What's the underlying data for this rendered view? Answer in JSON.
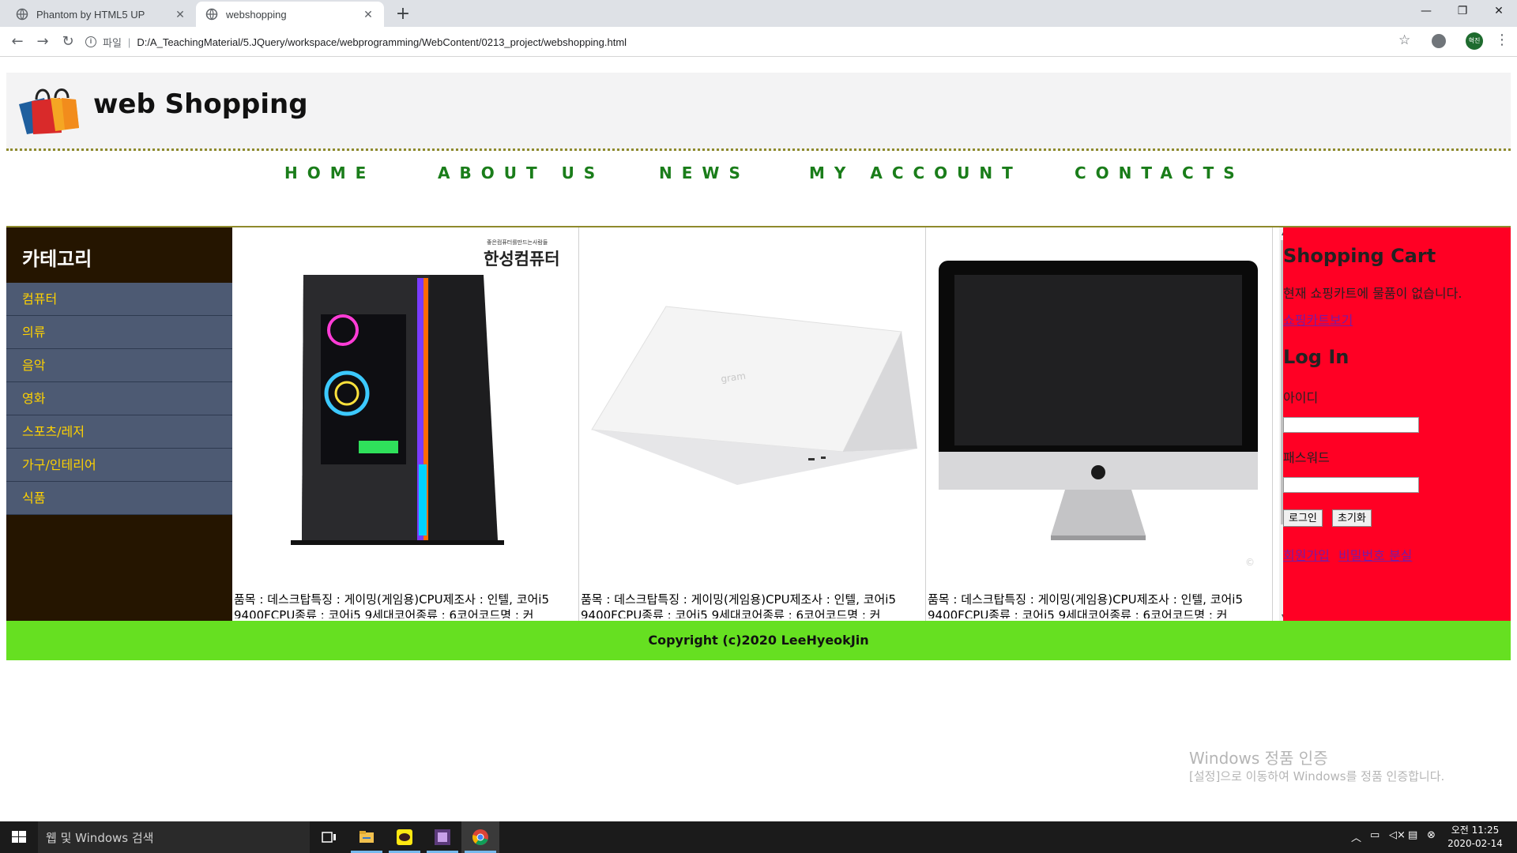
{
  "browser": {
    "tabs": [
      {
        "title": "Phantom by HTML5 UP",
        "active": false
      },
      {
        "title": "webshopping",
        "active": true
      }
    ],
    "new_tab": "+",
    "window_controls": {
      "minimize": "—",
      "restore": "❐",
      "close": "✕"
    },
    "address": {
      "scheme_label": "파일",
      "separator": "|",
      "url": "D:/A_TeachingMaterial/5.JQuery/workspace/webprogramming/WebContent/0213_project/webshopping.html"
    },
    "profile_label": "혁진"
  },
  "site": {
    "title": "web Shopping",
    "nav": [
      "HOME",
      "ABOUT US",
      "NEWS",
      "MY ACCOUNT",
      "CONTACTS"
    ]
  },
  "sidebar": {
    "title": "카테고리",
    "categories": [
      "컴퓨터",
      "의류",
      "음악",
      "영화",
      "스포츠/레저",
      "가구/인테리어",
      "식품"
    ]
  },
  "products": [
    {
      "brand_small": "좋은컴퓨터를만드는사람들",
      "brand": "한성컴퓨터",
      "desc": "품목 : 데스크탑특징 : 게이밍(게임용)CPU제조사 : 인텔, 코어i5 9400FCPU종류 : 코어i5 9세대코어종류 : 6코어코드명 : 커"
    },
    {
      "desc": "품목 : 데스크탑특징 : 게이밍(게임용)CPU제조사 : 인텔, 코어i5 9400FCPU종류 : 코어i5 9세대코어종류 : 6코어코드명 : 커"
    },
    {
      "desc": "품목 : 데스크탑특징 : 게이밍(게임용)CPU제조사 : 인텔, 코어i5 9400FCPU종류 : 코어i5 9세대코어종류 : 6코어코드명 : 커"
    }
  ],
  "cart": {
    "title": "Shopping Cart",
    "empty_message": "현재 쇼핑카트에 물품이 없습니다.",
    "view_link": "쇼핑카트보기"
  },
  "login": {
    "title": "Log In",
    "id_label": "아이디",
    "id_value": "",
    "pw_label": "패스워드",
    "pw_value": "",
    "login_button": "로그인",
    "reset_button": "초기화",
    "signup_link": "회원가입",
    "lost_pw_link": "비밀번호 분실"
  },
  "footer": {
    "copyright": "Copyright (c)2020 LeeHyeokJin"
  },
  "watermark": {
    "title": "Windows 정품 인증",
    "subtitle": "[설정]으로 이동하여 Windows를 정품 인증합니다."
  },
  "taskbar": {
    "search_placeholder": "웹 및 Windows 검색",
    "clock_time": "오전 11:25",
    "clock_date": "2020-02-14"
  },
  "colors": {
    "nav_text": "#1a7d1a",
    "sidebar_bg": "#251500",
    "category_bg": "#4d5a73",
    "category_text": "#ffd200",
    "rightbar_bg": "#ff0024",
    "footer_bg": "#66e021"
  }
}
